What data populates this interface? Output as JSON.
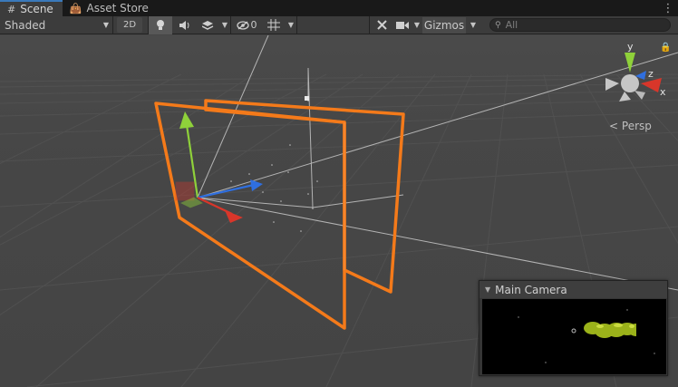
{
  "tabs": [
    {
      "label": "Scene",
      "icon": "grid-icon",
      "active": true
    },
    {
      "label": "Asset Store",
      "icon": "bag-icon",
      "active": false
    }
  ],
  "toolbar": {
    "draw_mode": "Shaded",
    "mode_2d": "2D",
    "hidden_count": "0",
    "gizmos_label": "Gizmos",
    "search_placeholder": "All"
  },
  "gizmo": {
    "axis_x": "x",
    "axis_y": "y",
    "axis_z": "z",
    "projection_label": "Persp"
  },
  "camera_preview": {
    "title": "Main Camera"
  },
  "colors": {
    "selection_outline": "#f47a1a",
    "axis_x": "#d8362a",
    "axis_y": "#8fd13a",
    "axis_z": "#2f6fe0",
    "tab_accent": "#3a79bb"
  }
}
